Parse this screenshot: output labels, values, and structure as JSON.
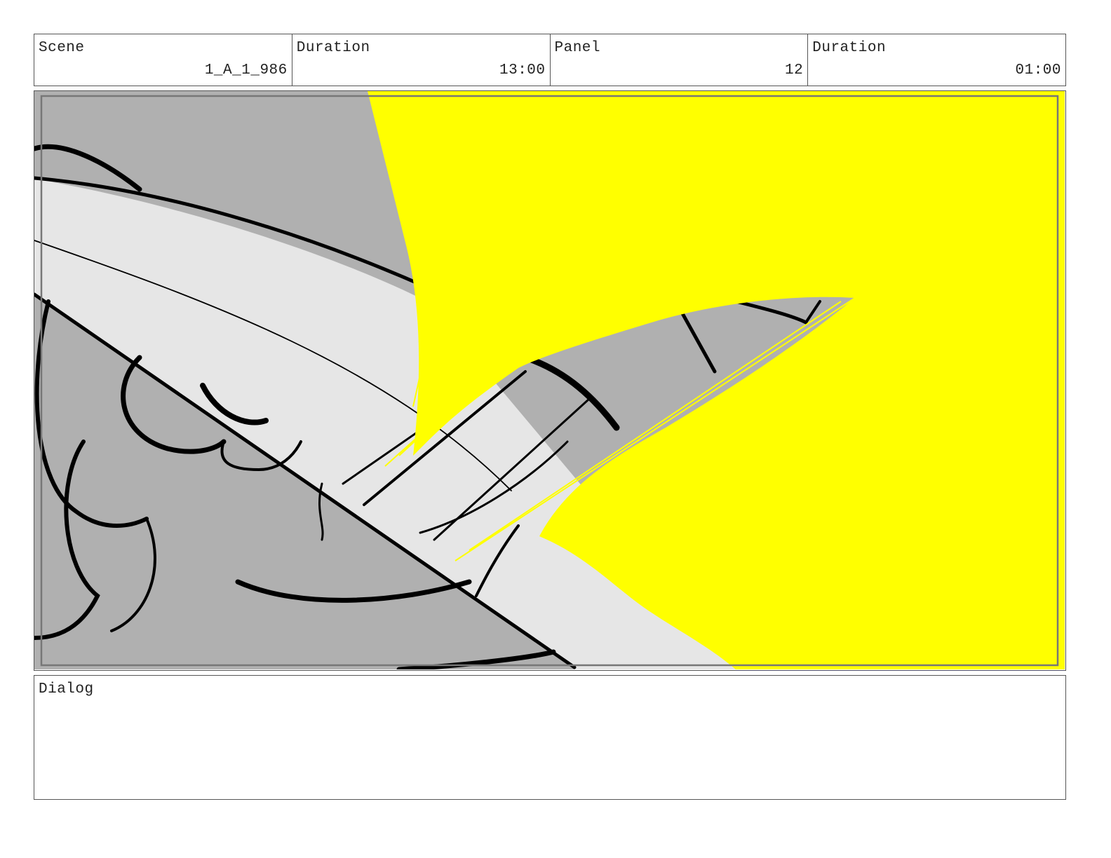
{
  "header": {
    "scene_label": "Scene",
    "scene_value": "1_A_1_986",
    "scene_duration_label": "Duration",
    "scene_duration_value": "13:00",
    "panel_label": "Panel",
    "panel_value": "12",
    "panel_duration_label": "Duration",
    "panel_duration_value": "01:00"
  },
  "dialog": {
    "label": "Dialog",
    "text": ""
  },
  "colors": {
    "flash": "#ffff00",
    "shadow": "#b0b0b0",
    "light": "#e6e6e6",
    "ink": "#000000"
  }
}
